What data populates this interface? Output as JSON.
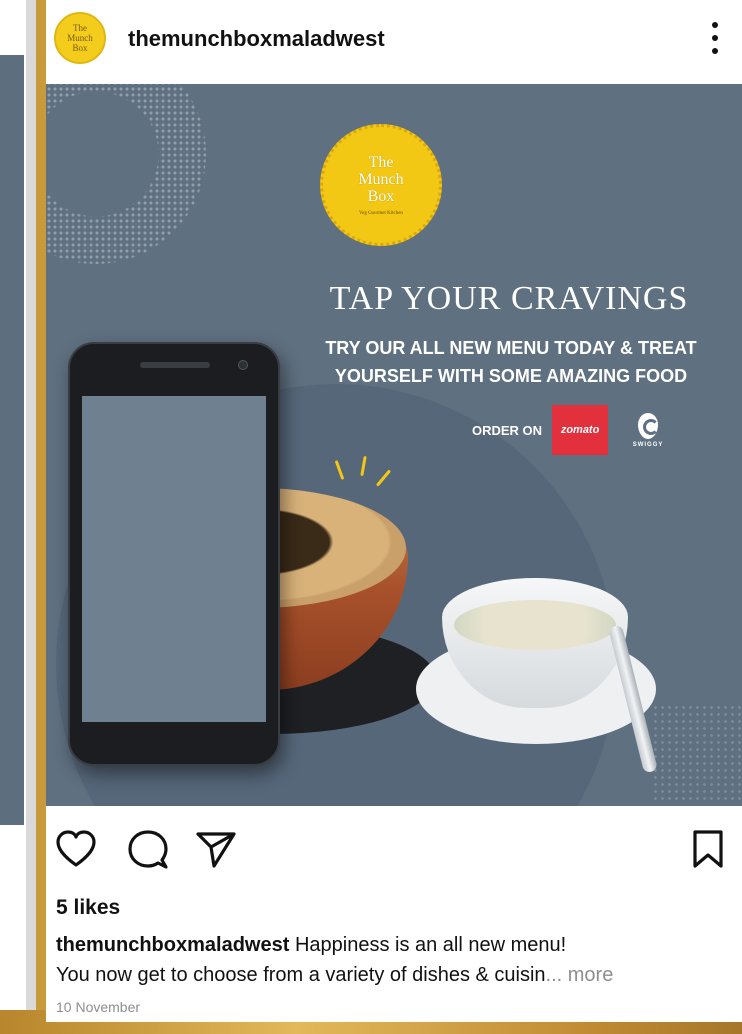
{
  "post": {
    "username": "themunchboxmaladwest",
    "avatar_text": [
      "The",
      "Munch",
      "Box"
    ],
    "image": {
      "logo_text": [
        "The",
        "Munch",
        "Box"
      ],
      "logo_subtext": "Veg Gourmet Kitchen",
      "headline": "TAP YOUR CRAVINGS",
      "subline_1": "TRY OUR ALL NEW MENU TODAY & TREAT",
      "subline_2": "YOURSELF WITH SOME AMAZING FOOD",
      "order_label": "ORDER ON",
      "zomato_label": "zomato",
      "swiggy_label": "SWIGGY"
    },
    "likes": "5 likes",
    "caption_user": "themunchboxmaladwest",
    "caption_line1": " Happiness is an all new menu!",
    "caption_line2": "You now get to choose from a variety of dishes & cuisin",
    "caption_ellipsis": "...",
    "caption_more": " more",
    "date": "10 November"
  },
  "colors": {
    "image_bg": "#5f7080",
    "brand_yellow": "#f2c814",
    "zomato_red": "#e2313d"
  },
  "icons": [
    "more-vertical-icon",
    "heart-icon",
    "comment-icon",
    "share-icon",
    "bookmark-icon"
  ]
}
